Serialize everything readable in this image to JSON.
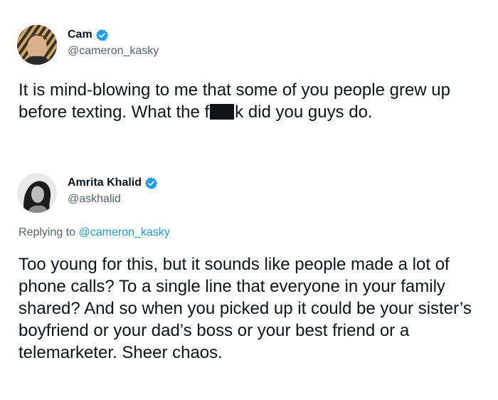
{
  "tweets": [
    {
      "display_name": "Cam",
      "handle": "@cameron_kasky",
      "verified": true,
      "text_before_censor": "It is mind-blowing to me that some of you people grew up before texting. What the f",
      "text_after_censor": "k did you guys do."
    },
    {
      "display_name": "Amrita Khalid",
      "handle": "@askhalid",
      "verified": true,
      "replying_to_label": "Replying to",
      "replying_to_handle": "@cameron_kasky",
      "text": "Too young for this, but it sounds like people made a lot of phone calls? To a single line that everyone in your family shared? And so when you picked up it could be your sister’s boyfriend or your dad’s boss or your best friend or a telemarketer. Sheer chaos."
    }
  ],
  "colors": {
    "verified_badge": "#1d9bf0",
    "secondary_text": "#536471",
    "link": "#1d9bf0",
    "primary_text": "#0f1419"
  }
}
